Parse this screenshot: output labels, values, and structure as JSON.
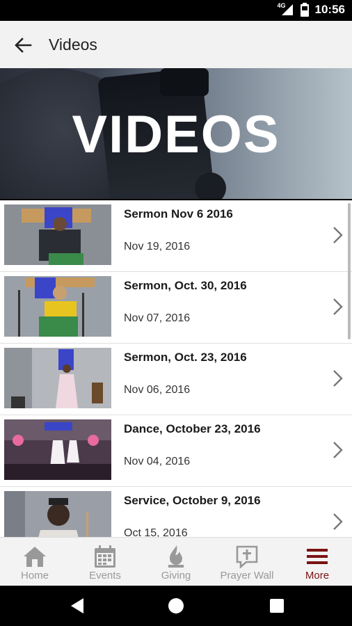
{
  "status_bar": {
    "time": "10:56",
    "network": "4G"
  },
  "app_bar": {
    "title": "Videos"
  },
  "banner": {
    "text": "VIDEOS"
  },
  "videos": [
    {
      "title": "Sermon Nov 6 2016",
      "date": "Nov 19, 2016"
    },
    {
      "title": "Sermon, Oct. 30, 2016",
      "date": "Nov 07, 2016"
    },
    {
      "title": "Sermon, Oct. 23, 2016",
      "date": "Nov 06, 2016"
    },
    {
      "title": "Dance, October 23, 2016",
      "date": "Nov 04, 2016"
    },
    {
      "title": "Service, October 9, 2016",
      "date": "Oct 15, 2016"
    }
  ],
  "bottom_nav": [
    {
      "label": "Home",
      "icon": "home-icon",
      "active": false
    },
    {
      "label": "Events",
      "icon": "calendar-icon",
      "active": false
    },
    {
      "label": "Giving",
      "icon": "flame-icon",
      "active": false
    },
    {
      "label": "Prayer Wall",
      "icon": "prayer-icon",
      "active": false
    },
    {
      "label": "More",
      "icon": "menu-icon",
      "active": true
    }
  ],
  "colors": {
    "accent": "#7b1212",
    "inactive": "#999999",
    "app_bar": "#f2f2f2"
  }
}
